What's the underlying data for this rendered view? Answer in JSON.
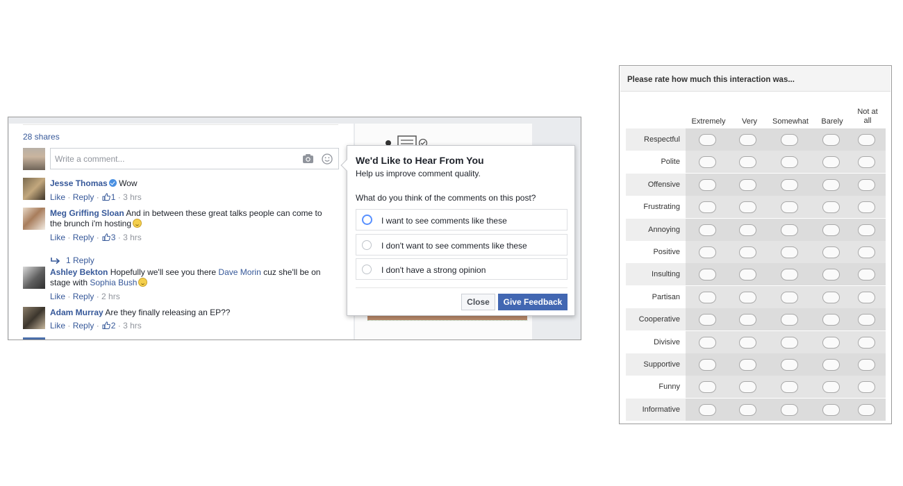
{
  "facebook": {
    "shares": "28 shares",
    "composer_placeholder": "Write a comment...",
    "comments": [
      {
        "name": "Jesse Thomas",
        "text": "Wow",
        "verified": true,
        "like": "Like",
        "reply": "Reply",
        "likes": "1",
        "time": "3 hrs"
      },
      {
        "name": "Meg Griffing Sloan",
        "text": "And in between these great talks people can come to the brunch i'm hosting",
        "like": "Like",
        "reply": "Reply",
        "likes": "3",
        "time": "3 hrs",
        "replies": "1 Reply"
      },
      {
        "name": "Ashley Bekton",
        "text_a": "Hopefully we'll see you there",
        "link_a": "Dave Morin",
        "text_b": "cuz she'll be on stage with",
        "link_b": "Sophia Bush",
        "like": "Like",
        "reply": "Reply",
        "time": "2 hrs"
      },
      {
        "name": "Adam Murray",
        "text": "Are they finally releasing an EP??",
        "like": "Like",
        "reply": "Reply",
        "likes": "2",
        "time": "3 hrs"
      }
    ],
    "popup": {
      "title": "We'd Like to Hear From You",
      "subtitle": "Help us improve comment quality.",
      "question": "What do you think of the comments on this post?",
      "options": [
        "I want to see comments like these",
        "I don't want to see comments like these",
        "I don't have a strong opinion"
      ],
      "selected_option": 0,
      "close_label": "Close",
      "feedback_label": "Give Feedback",
      "accent_color": "#4267b2"
    }
  },
  "survey": {
    "title": "Please rate how much this interaction was...",
    "columns": [
      "Extremely",
      "Very",
      "Somewhat",
      "Barely",
      "Not at all"
    ],
    "rows": [
      "Respectful",
      "Polite",
      "Offensive",
      "Frustrating",
      "Annoying",
      "Positive",
      "Insulting",
      "Partisan",
      "Cooperative",
      "Divisive",
      "Supportive",
      "Funny",
      "Informative"
    ]
  }
}
